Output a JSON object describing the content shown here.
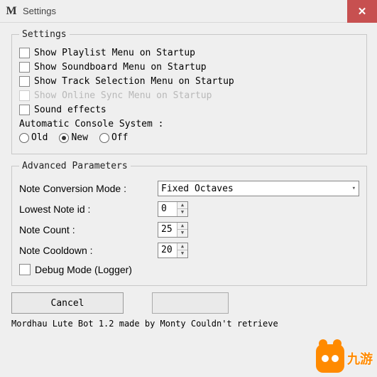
{
  "titlebar": {
    "title": "Settings",
    "close": "✕"
  },
  "settings": {
    "legend": "Settings",
    "items": [
      {
        "label": "Show Playlist Menu on Startup",
        "disabled": false
      },
      {
        "label": "Show Soundboard Menu on Startup",
        "disabled": false
      },
      {
        "label": "Show Track Selection Menu on Startup",
        "disabled": false
      },
      {
        "label": "Show Online Sync Menu on Startup",
        "disabled": true
      },
      {
        "label": "Sound effects",
        "disabled": false
      }
    ],
    "acs_label": "Automatic Console System :",
    "acs_options": [
      "Old",
      "New",
      "Off"
    ],
    "acs_selected": "New"
  },
  "advanced": {
    "legend": "Advanced Parameters",
    "note_conv_label": "Note Conversion Mode :",
    "note_conv_value": "Fixed Octaves",
    "lowest_label": "Lowest Note id :",
    "lowest_value": "0",
    "count_label": "Note Count :",
    "count_value": "25",
    "cooldown_label": "Note Cooldown :",
    "cooldown_value": "20",
    "debug_label": "Debug Mode (Logger)"
  },
  "buttons": {
    "cancel": "Cancel",
    "ok": ""
  },
  "footer": "Mordhau Lute Bot 1.2 made by Monty  Couldn't retrieve",
  "watermark": "九游"
}
